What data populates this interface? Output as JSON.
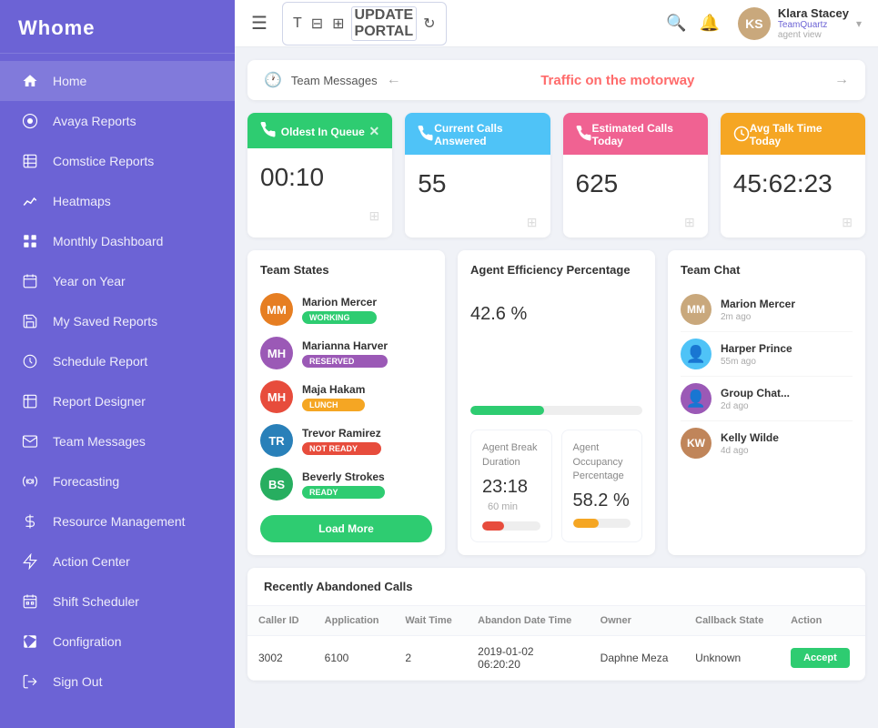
{
  "sidebar": {
    "logo": "Whome",
    "items": [
      {
        "label": "Home",
        "icon": "🏠"
      },
      {
        "label": "Avaya Reports",
        "icon": "📊"
      },
      {
        "label": "Comstice Reports",
        "icon": "📋"
      },
      {
        "label": "Heatmaps",
        "icon": "📈"
      },
      {
        "label": "Monthly Dashboard",
        "icon": "📅"
      },
      {
        "label": "Year on Year",
        "icon": "📄"
      },
      {
        "label": "My Saved Reports",
        "icon": "💾"
      },
      {
        "label": "Schedule Report",
        "icon": "⏰"
      },
      {
        "label": "Report Designer",
        "icon": "📊"
      },
      {
        "label": "Team Messages",
        "icon": "✉️"
      },
      {
        "label": "Forecasting",
        "icon": "⚙️"
      },
      {
        "label": "Resource Management",
        "icon": "🚀"
      },
      {
        "label": "Action Center",
        "icon": "🎯"
      },
      {
        "label": "Shift Scheduler",
        "icon": "📆"
      },
      {
        "label": "Configration",
        "icon": "⚙️"
      },
      {
        "label": "Sign Out",
        "icon": "🚪"
      }
    ]
  },
  "topbar": {
    "user": {
      "name": "Klara Stacey",
      "team": "TeamQuartz",
      "role": "agent view"
    }
  },
  "banner": {
    "label": "Team Messages",
    "traffic": "Traffic on the motorway"
  },
  "stat_cards": [
    {
      "color": "green",
      "label": "Oldest In Queue",
      "value": "00:10",
      "show_close": true
    },
    {
      "color": "blue",
      "label": "Current Calls Answered",
      "value": "55",
      "show_close": false
    },
    {
      "color": "pink",
      "label": "Estimated Calls Today",
      "value": "625",
      "show_close": false
    },
    {
      "color": "yellow",
      "label": "Avg Talk Time Today",
      "value": "45:62:23",
      "show_close": false
    }
  ],
  "team_states": {
    "title": "Team States",
    "members": [
      {
        "name": "Marion Mercer",
        "badge": "WORKING",
        "badge_type": "working"
      },
      {
        "name": "Marianna Harver",
        "badge": "RESERVED",
        "badge_type": "reserved"
      },
      {
        "name": "Maja Hakam",
        "badge": "LUNCH",
        "badge_type": "lunch"
      },
      {
        "name": "Trevor Ramirez",
        "badge": "NOT READY",
        "badge_type": "not-ready"
      },
      {
        "name": "Beverly Strokes",
        "badge": "READY",
        "badge_type": "ready"
      }
    ],
    "load_more": "Load More"
  },
  "agent_efficiency": {
    "title": "Agent Efficiency Percentage",
    "percentage": "42.6 %",
    "progress": 42.6,
    "sub_cards": [
      {
        "label": "Agent Break Duration",
        "value": "23:18",
        "extra": "60 min",
        "progress": 38,
        "color": "red"
      },
      {
        "label": "Agent Occupancy Percentage",
        "value": "58.2 %",
        "progress": 45,
        "color": "yellow"
      }
    ]
  },
  "team_chat": {
    "title": "Team Chat",
    "members": [
      {
        "name": "Marion Mercer",
        "time": "2m ago",
        "avatar_type": "brown"
      },
      {
        "name": "Harper Prince",
        "time": "55m ago",
        "avatar_type": "blue"
      },
      {
        "name": "Group Chat...",
        "time": "2d ago",
        "avatar_type": "purple"
      },
      {
        "name": "Kelly Wilde",
        "time": "4d ago",
        "avatar_type": "brown2"
      }
    ]
  },
  "abandoned_calls": {
    "title": "Recently Abandoned Calls",
    "columns": [
      "Caller ID",
      "Application",
      "Wait Time",
      "Abandon Date Time",
      "Owner",
      "Callback State",
      "Action"
    ],
    "rows": [
      {
        "caller_id": "3002",
        "application": "6100",
        "wait_time": "2",
        "abandon_date": "2019-01-02\n06:20:20",
        "owner": "Daphne Meza",
        "callback_state": "Unknown",
        "action": "Accept"
      }
    ]
  }
}
